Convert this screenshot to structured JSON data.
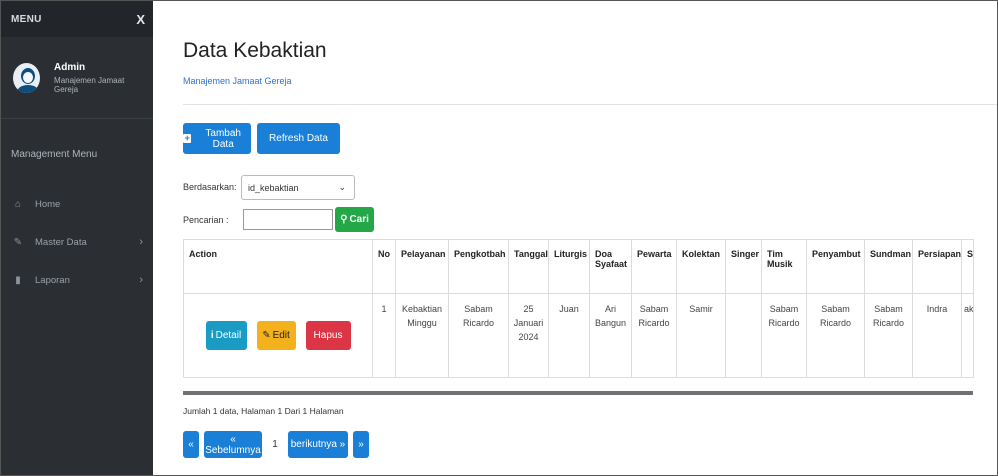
{
  "sidebar": {
    "title": "MENU",
    "close_symbol": "X",
    "user": {
      "name": "Admin",
      "role": "Manajemen Jamaat Gereja",
      "avatar_icon": "user-avatar-icon"
    },
    "section": "Management Menu",
    "items": [
      {
        "label": "Home",
        "icon": "home-icon",
        "arrow": ""
      },
      {
        "label": "Master Data",
        "icon": "edit-icon",
        "arrow": "›"
      },
      {
        "label": "Laporan",
        "icon": "file-icon",
        "arrow": "›"
      }
    ]
  },
  "header": {
    "title": "Data Kebaktian",
    "subtitle": "Manajemen Jamaat Gereja"
  },
  "toolbar": {
    "add_label": "Tambah Data",
    "refresh_label": "Refresh Data"
  },
  "filter": {
    "by_label": "Berdasarkan:",
    "by_value": "id_kebaktian",
    "search_label": "Pencarian :",
    "search_value": "",
    "search_button": "Cari"
  },
  "table": {
    "columns": [
      "Action",
      "No",
      "Pelayanan",
      "Pengkotbah",
      "Tanggal",
      "Liturgis",
      "Doa Syafaat",
      "Pewarta",
      "Kolektan",
      "Singer",
      "Tim Musik",
      "Penyambut",
      "Sundman",
      "Persiapan",
      "Statu"
    ],
    "row": {
      "actions": {
        "detail": "Detail",
        "edit": "Edit",
        "delete": "Hapus"
      },
      "cells": [
        "1",
        "Kebaktian Minggu",
        "Sabam Ricardo",
        "25 Januari 2024",
        "Juan",
        "Ari Bangun",
        "Sabam Ricardo",
        "Samir",
        "",
        "Sabam Ricardo",
        "Sabam Ricardo",
        "Sabam Ricardo",
        "Indra",
        "aktif"
      ]
    }
  },
  "footer": {
    "info": "Jumlah 1 data, Halaman 1 Dari 1 Halaman"
  },
  "pagination": {
    "first": "«",
    "prev": "« Sebelumnya",
    "current": "1",
    "next": "berikutnya »",
    "last": "»"
  },
  "colors": {
    "sidebar_bg": "#2b2f33",
    "primary": "#1a7fd6",
    "info": "#1a9bc4",
    "warning": "#f3b21b",
    "danger": "#dc3545",
    "success": "#24a746"
  }
}
